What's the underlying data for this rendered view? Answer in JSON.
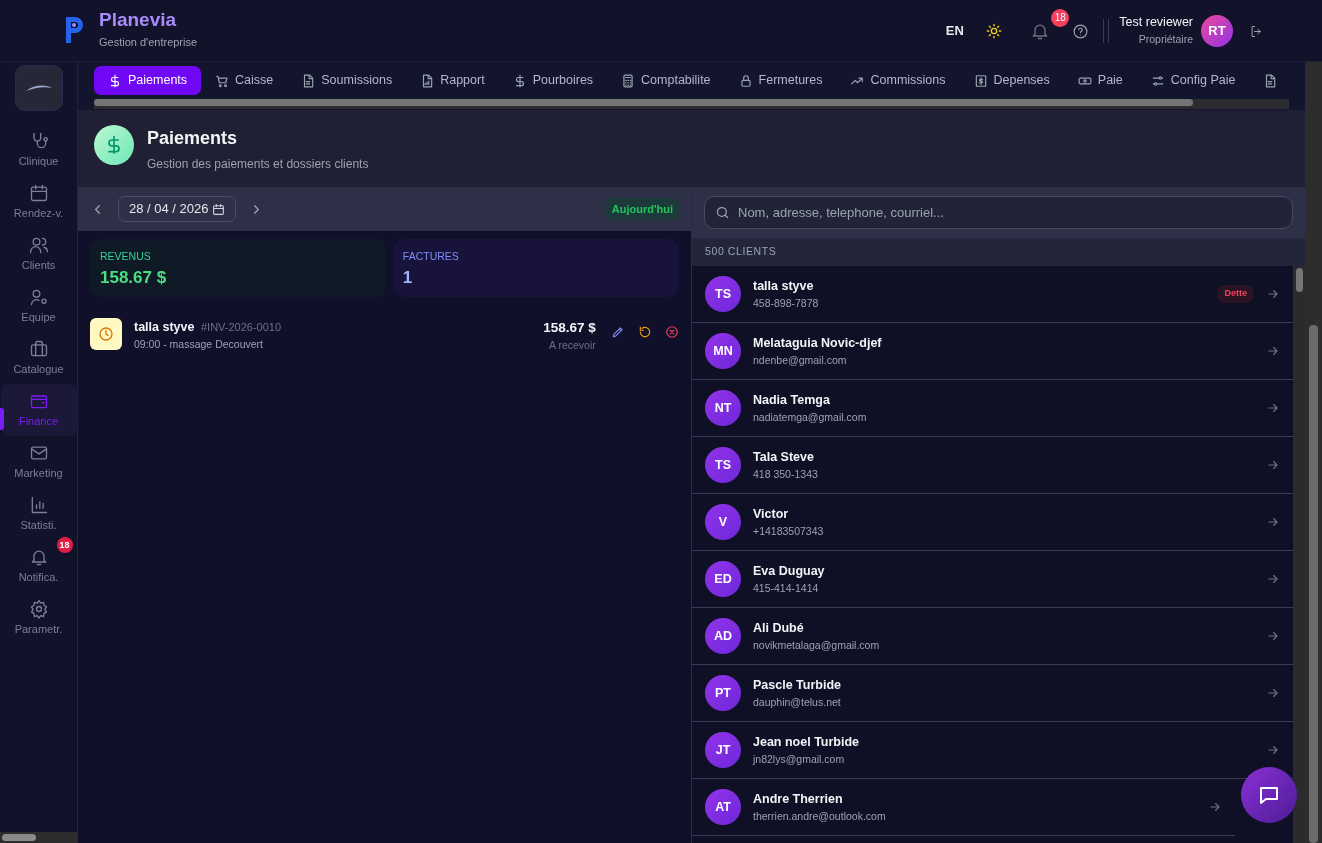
{
  "app": {
    "name": "Planevia",
    "tagline": "Gestion d'entreprise"
  },
  "header": {
    "language": "EN",
    "notification_count": "18",
    "user": {
      "name": "Test reviewer",
      "role": "Propriétaire",
      "initials": "RT"
    }
  },
  "sidebar": {
    "items": [
      {
        "label": "Clinique",
        "selected": false
      },
      {
        "label": "Rendez-v.",
        "selected": false
      },
      {
        "label": "Clients",
        "selected": false
      },
      {
        "label": "Equipe",
        "selected": false
      },
      {
        "label": "Catalogue",
        "selected": false
      },
      {
        "label": "Finance",
        "selected": true
      },
      {
        "label": "Marketing",
        "selected": false
      },
      {
        "label": "Statisti.",
        "selected": false
      },
      {
        "label": "Notifica.",
        "selected": false,
        "badge": "18"
      },
      {
        "label": "Parametr.",
        "selected": false
      }
    ]
  },
  "tabs": [
    {
      "label": "Paiements",
      "selected": true
    },
    {
      "label": "Caisse",
      "selected": false
    },
    {
      "label": "Soumissions",
      "selected": false
    },
    {
      "label": "Rapport",
      "selected": false
    },
    {
      "label": "Pourboires",
      "selected": false
    },
    {
      "label": "Comptabilite",
      "selected": false
    },
    {
      "label": "Fermetures",
      "selected": false
    },
    {
      "label": "Commissions",
      "selected": false
    },
    {
      "label": "Depenses",
      "selected": false
    },
    {
      "label": "Paie",
      "selected": false
    },
    {
      "label": "Config Paie",
      "selected": false
    },
    {
      "selected": false
    }
  ],
  "page": {
    "title": "Paiements",
    "subtitle": "Gestion des paiements et dossiers clients"
  },
  "date_bar": {
    "date": "28 / 04 / 2026",
    "today_label": "Aujourd'hui"
  },
  "stats": [
    {
      "kind": "revenue",
      "label": "REVENUS",
      "value": "158.67 $"
    },
    {
      "kind": "invoices",
      "label": "FACTURES",
      "value": "1"
    }
  ],
  "payments": [
    {
      "client": "talla styve",
      "invoice": "#INV-2026-0010",
      "detail": "09:00 - massage Decouvert",
      "amount": "158.67 $",
      "status": "A recevoir"
    }
  ],
  "search": {
    "placeholder": "Nom, adresse, telephone, courriel..."
  },
  "client_count": "500 CLIENTS",
  "clients": [
    {
      "initials": "TS",
      "name": "talla styve",
      "contact": "458-898-7878",
      "tag": "Dette"
    },
    {
      "initials": "MN",
      "name": "Melataguia Novic-djef",
      "contact": "ndenbe@gmail.com"
    },
    {
      "initials": "NT",
      "name": "Nadia Temga",
      "contact": "nadiatemga@gmail.com"
    },
    {
      "initials": "TS",
      "name": "Tala Steve",
      "contact": "418 350-1343"
    },
    {
      "initials": "V",
      "name": "Victor",
      "contact": "+14183507343"
    },
    {
      "initials": "ED",
      "name": "Eva Duguay",
      "contact": "415-414-1414"
    },
    {
      "initials": "AD",
      "name": "Ali Dubé",
      "contact": "novikmetalaga@gmail.com"
    },
    {
      "initials": "PT",
      "name": "Pascle Turbide",
      "contact": "dauphin@telus.net"
    },
    {
      "initials": "JT",
      "name": "Jean noel Turbide",
      "contact": "jn82lys@gmail.com"
    },
    {
      "initials": "AT",
      "name": "Andre Therrien",
      "contact": "therrien.andre@outlook.com"
    }
  ]
}
